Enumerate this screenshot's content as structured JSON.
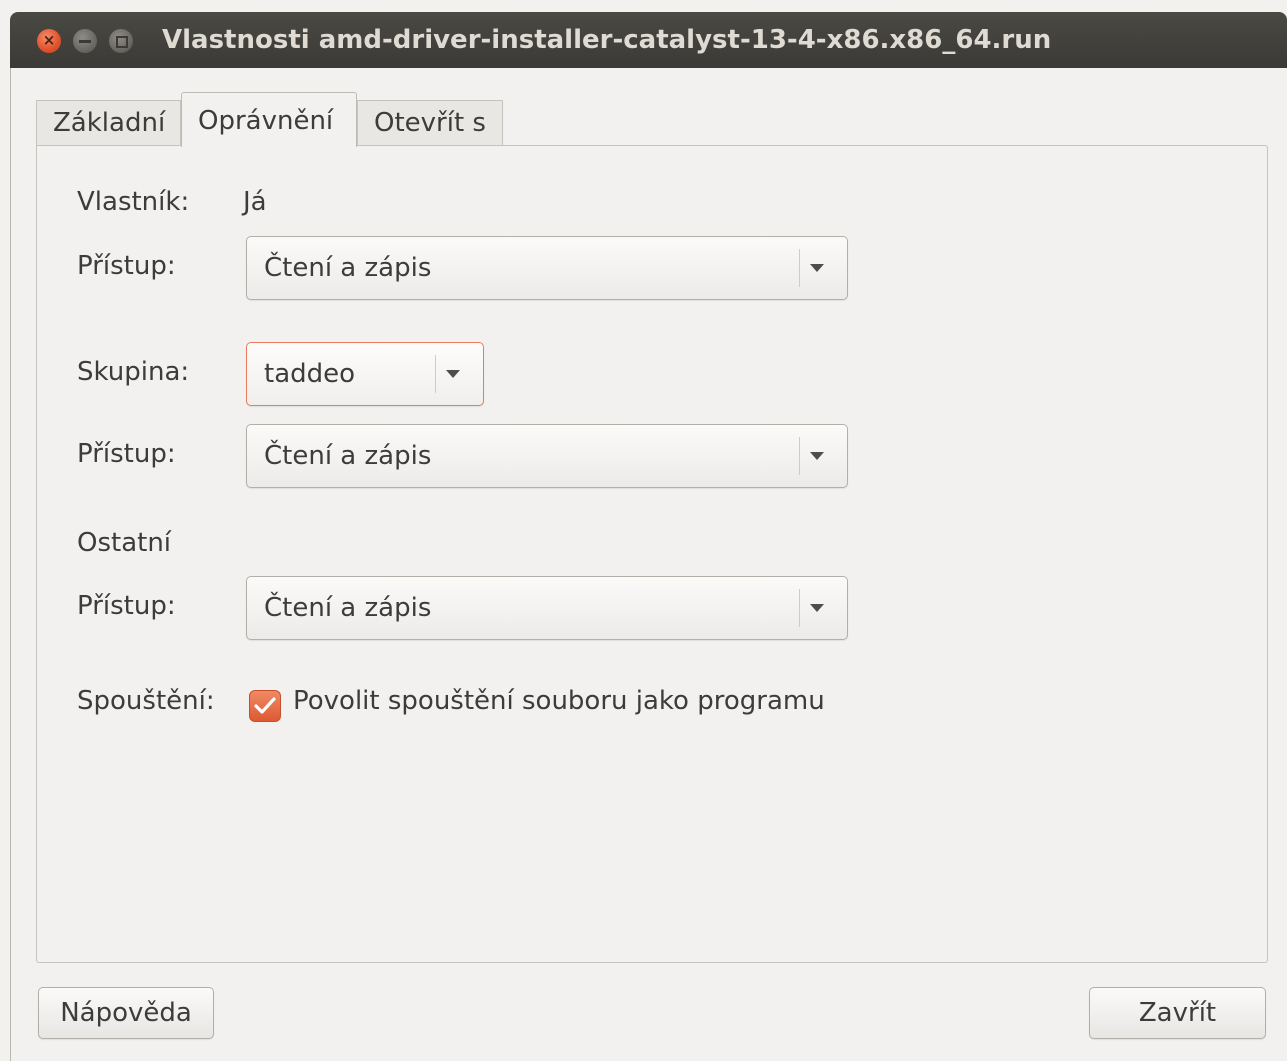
{
  "window": {
    "title": "Vlastnosti amd-driver-installer-catalyst-13-4-x86.x86_64.run"
  },
  "tabs": [
    {
      "label": "Základní",
      "active": false
    },
    {
      "label": "Oprávnění",
      "active": true
    },
    {
      "label": "Otevřít s",
      "active": false
    }
  ],
  "owner": {
    "label": "Vlastník:",
    "value": "Já",
    "access_label": "Přístup:",
    "access_value": "Čtení a zápis"
  },
  "group": {
    "label": "Skupina:",
    "value": "taddeo",
    "access_label": "Přístup:",
    "access_value": "Čtení a zápis"
  },
  "others": {
    "label": "Ostatní",
    "access_label": "Přístup:",
    "access_value": "Čtení a zápis"
  },
  "execute": {
    "label": "Spouštění:",
    "checkbox_label": "Povolit spouštění souboru jako programu",
    "checked": true
  },
  "footer": {
    "help_label": "Nápověda",
    "close_label": "Zavřít"
  },
  "colors": {
    "accent": "#dd5a33",
    "titlebar": "#3b3a36",
    "window_bg": "#f2f1f0"
  }
}
